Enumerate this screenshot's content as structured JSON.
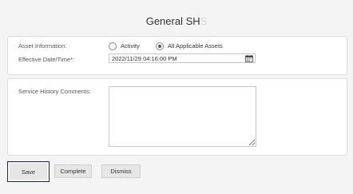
{
  "header": {
    "title_main": "General SH",
    "title_faded": "S"
  },
  "asset_info": {
    "label": "Asset Information:",
    "options": [
      {
        "label": "Activity",
        "checked": false
      },
      {
        "label": "All Applicable Assets",
        "checked": true
      }
    ]
  },
  "effective_date": {
    "label": "Effective Date/Time*:",
    "value": "2022/11/29 04:16:00 PM",
    "icon": "calendar-icon"
  },
  "comments": {
    "label": "Service History Comments:",
    "value": ""
  },
  "buttons": {
    "save": "Save",
    "complete": "Complete",
    "dismiss": "Dismiss"
  },
  "colors": {
    "focus_outline": "#1a237e",
    "background": "#f4f4f4"
  }
}
